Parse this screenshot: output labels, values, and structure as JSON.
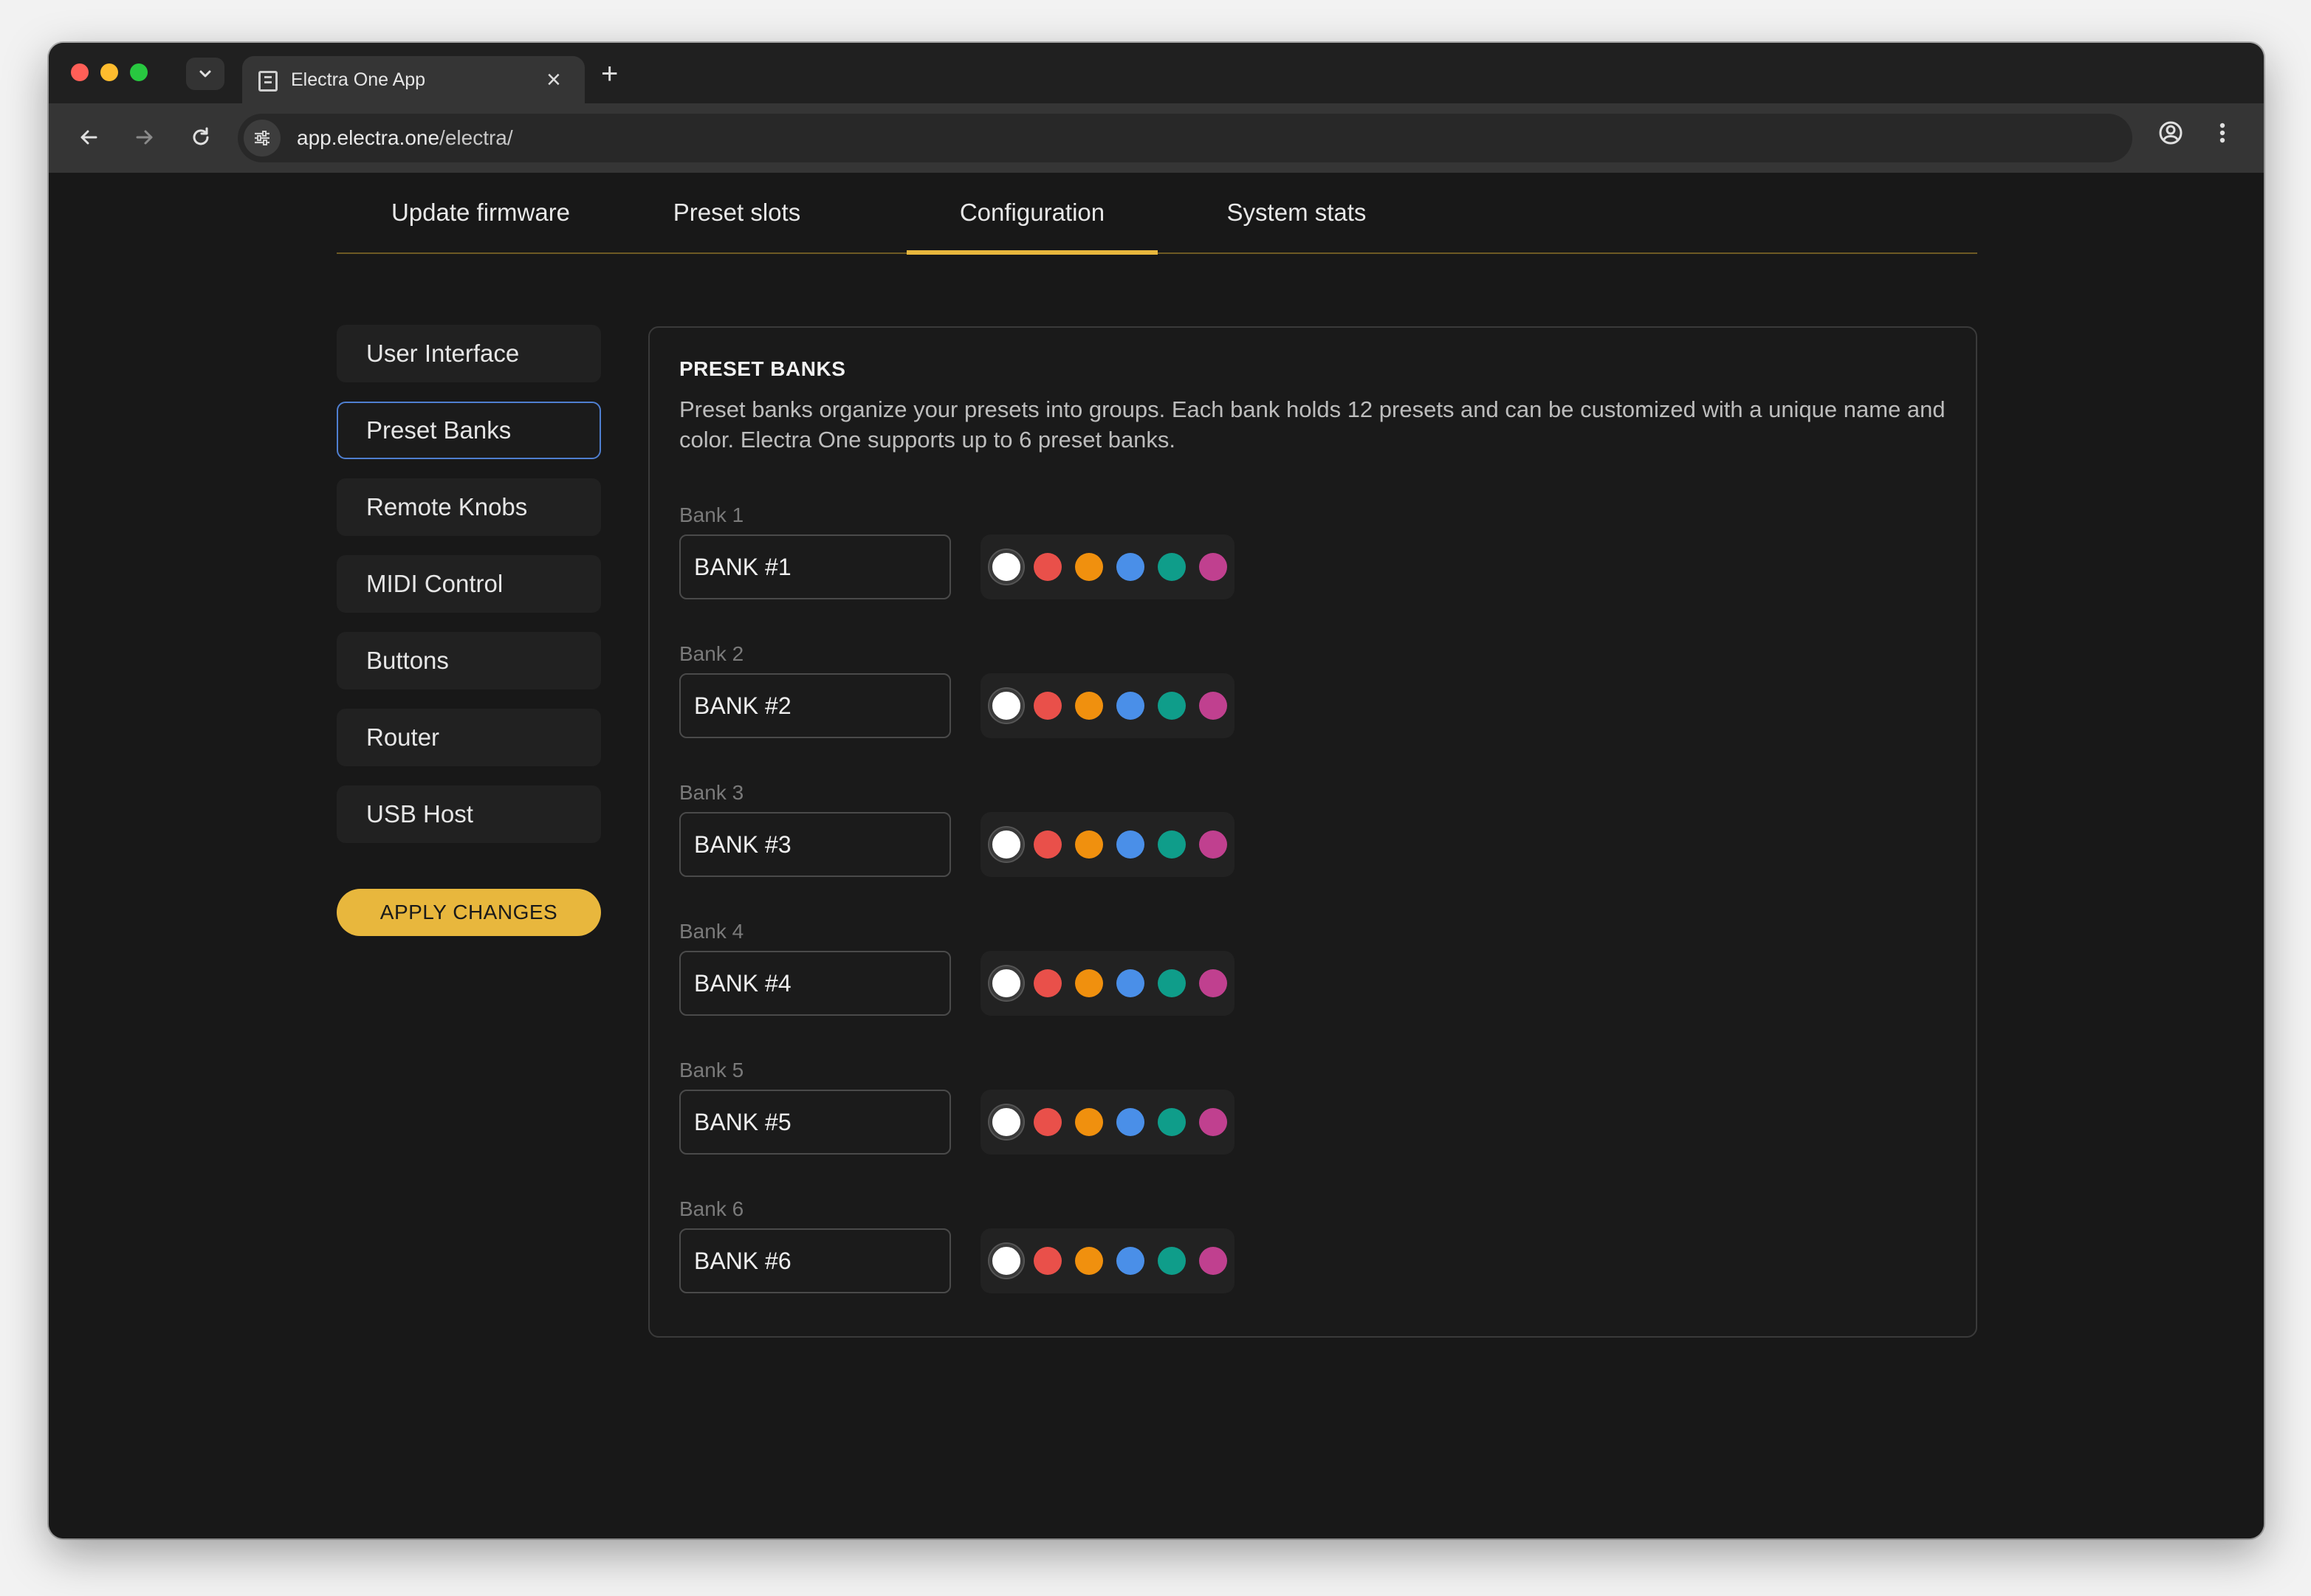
{
  "browser": {
    "tab_title": "Electra One App",
    "url_domain": "app.electra.one",
    "url_path": "/electra/"
  },
  "tabs": [
    {
      "label": "Update firmware"
    },
    {
      "label": "Preset slots"
    },
    {
      "label": "Configuration",
      "active": true
    },
    {
      "label": "System stats"
    }
  ],
  "sidebar": {
    "items": [
      {
        "label": "User Interface"
      },
      {
        "label": "Preset Banks",
        "active": true
      },
      {
        "label": "Remote Knobs"
      },
      {
        "label": "MIDI Control"
      },
      {
        "label": "Buttons"
      },
      {
        "label": "Router"
      },
      {
        "label": "USB Host"
      }
    ],
    "apply_label": "APPLY CHANGES"
  },
  "panel": {
    "title": "PRESET BANKS",
    "description": "Preset banks organize your presets into groups. Each bank holds 12 presets and can be customized with a unique name and color. Electra One supports up to 6 preset banks."
  },
  "swatch_colors": [
    "#ffffff",
    "#e9504a",
    "#f0900e",
    "#4a8fe8",
    "#0f9d8a",
    "#c0408f"
  ],
  "banks": [
    {
      "label": "Bank 1",
      "name": "BANK #1",
      "selected_color": 0
    },
    {
      "label": "Bank 2",
      "name": "BANK #2",
      "selected_color": 0
    },
    {
      "label": "Bank 3",
      "name": "BANK #3",
      "selected_color": 0
    },
    {
      "label": "Bank 4",
      "name": "BANK #4",
      "selected_color": 0
    },
    {
      "label": "Bank 5",
      "name": "BANK #5",
      "selected_color": 0
    },
    {
      "label": "Bank 6",
      "name": "BANK #6",
      "selected_color": 0
    }
  ]
}
